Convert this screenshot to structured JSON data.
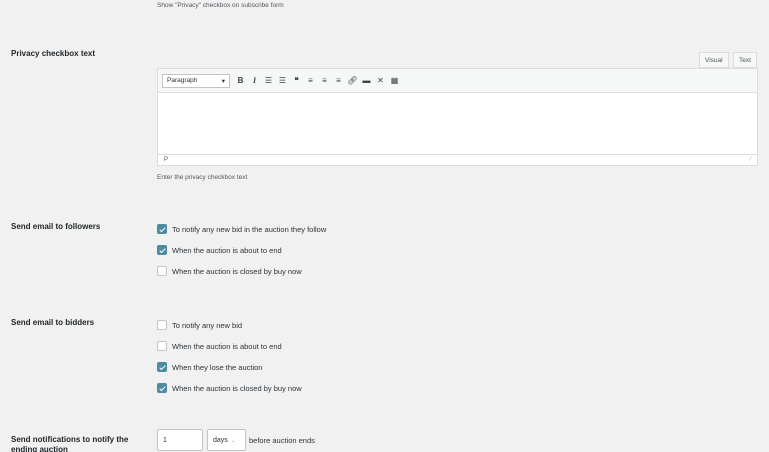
{
  "privacy_show": {
    "description": "Show \"Privacy\" checkbox on subscribe form"
  },
  "privacy_text": {
    "label": "Privacy checkbox text",
    "tabs": [
      "Visual",
      "Text"
    ],
    "format_select": "Paragraph",
    "path": "P",
    "description": "Enter the privacy checkbox text",
    "toolbar_icons": [
      "bold-icon",
      "italic-icon",
      "bullet-list-icon",
      "numbered-list-icon",
      "blockquote-icon",
      "align-left-icon",
      "align-center-icon",
      "align-right-icon",
      "link-icon",
      "read-more-icon",
      "fullscreen-icon",
      "toolbar-toggle-icon"
    ]
  },
  "followers": {
    "label": "Send email to followers",
    "options": [
      {
        "label": "To notify any new bid in the auction they follow",
        "checked": true
      },
      {
        "label": "When the auction is about to end",
        "checked": true
      },
      {
        "label": "When the auction is closed by buy now",
        "checked": false
      }
    ]
  },
  "bidders": {
    "label": "Send email to bidders",
    "options": [
      {
        "label": "To notify any new bid",
        "checked": false
      },
      {
        "label": "When the auction is about to end",
        "checked": false
      },
      {
        "label": "When they lose the auction",
        "checked": true
      },
      {
        "label": "When the auction is closed by buy now",
        "checked": true
      }
    ]
  },
  "notify_ending": {
    "label": "Send notifications to notify the ending auction",
    "value": "1",
    "unit": "days",
    "suffix": "before auction ends"
  },
  "colors": {
    "accent": "#4e8aa0",
    "background": "#f1f1f1"
  }
}
